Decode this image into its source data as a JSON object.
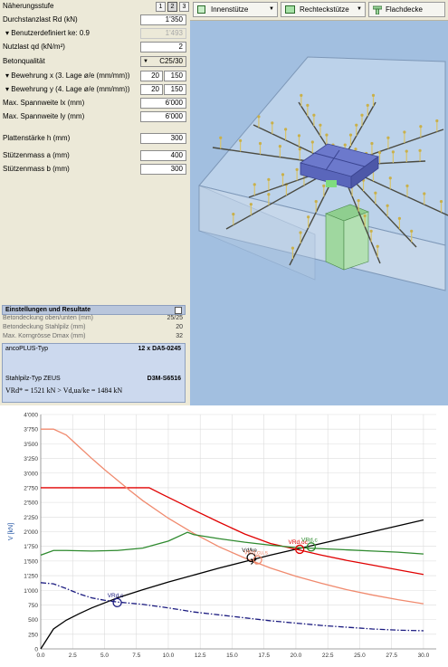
{
  "left_panel": {
    "approx_level_label": "Näherungsstufe",
    "levels": [
      "1",
      "2",
      "3"
    ],
    "active_level": "2",
    "punching_load_label": "Durchstanzlast Rd (kN)",
    "punching_load_value": "1'350",
    "user_defined_label": "Benutzerdefiniert ke: 0.9",
    "user_defined_value": "1'493",
    "live_load_label": "Nutzlast qd (kN/m²)",
    "live_load_value": "2",
    "concrete_label": "Betonqualität",
    "concrete_value": "C25/30",
    "rebar_x_label": "Bewehrung x (3. Lage ø/e (mm/mm))",
    "rebar_x_diameter": "20",
    "rebar_x_spacing": "150",
    "rebar_y_label": "Bewehrung y (4. Lage ø/e (mm/mm))",
    "rebar_y_diameter": "20",
    "rebar_y_spacing": "150",
    "span_x_label": "Max. Spannweite lx  (mm)",
    "span_x_value": "6'000",
    "span_y_label": "Max. Spannweite ly  (mm)",
    "span_y_value": "6'000",
    "slab_label": "Plattenstärke h (mm)",
    "slab_value": "300",
    "col_a_label": "Stützenmass a (mm)",
    "col_a_value": "400",
    "col_b_label": "Stützenmass b (mm)",
    "col_b_value": "300"
  },
  "settings": {
    "title": "Einstellungen und Resultate",
    "rows": [
      {
        "label": "Betondeckung oben/unten (mm)",
        "value": "25/25"
      },
      {
        "label": "Betondeckung Stahlpilz (mm)",
        "value": "20"
      },
      {
        "label": "Max. Korngrösse Dmax (mm)",
        "value": "32"
      }
    ]
  },
  "result": {
    "type_label": "ancoPLUS-Typ",
    "type_value": "12 x DA5-0245",
    "steel_label": "Stahlpilz-Typ ZEUS",
    "steel_value": "D3M-S6516",
    "formula": "VRd* = 1521 kN > Vd,ua/ke = 1484 kN"
  },
  "toolbar": {
    "inner_column": "Innenstütze",
    "rect_column": "Rechteckstütze",
    "flat_slab": "Flachdecke"
  },
  "colors": {
    "panel_bg": "#ece9d8",
    "view_bg": "#a2bfe0",
    "result_bg": "#ccd9ee",
    "series_black": "#000000",
    "series_red": "#e00000",
    "series_salmon": "#f08a6e",
    "series_green": "#2f8a2f",
    "series_navy": "#1b1b80"
  },
  "chart_data": {
    "type": "line",
    "ylabel": "V [kN]",
    "ylim": [
      0,
      4000
    ],
    "xlim": [
      0,
      31
    ],
    "y_ticks": [
      "4'000",
      "3'750",
      "3'500",
      "3'250",
      "3'000",
      "2'750",
      "2'500",
      "2'250",
      "2'000",
      "1'750",
      "1'500",
      "1'250",
      "1'000",
      "750",
      "500",
      "250",
      "0"
    ],
    "x_ticks": [
      "0.0",
      "2.5",
      "5.0",
      "7.5",
      "10.0",
      "12.5",
      "15.0",
      "17.5",
      "20.0",
      "22.5",
      "25.0",
      "27.5",
      "30.0"
    ],
    "grid": true,
    "series": [
      {
        "name": "",
        "style": "solid",
        "color": "#000000",
        "x": [
          0,
          1,
          2,
          3,
          4,
          6,
          8,
          10,
          12,
          14,
          16,
          18,
          20,
          22,
          24,
          26,
          28,
          30
        ],
        "y": [
          0,
          340,
          490,
          600,
          700,
          870,
          1010,
          1140,
          1260,
          1380,
          1490,
          1600,
          1700,
          1800,
          1900,
          2000,
          2100,
          2200
        ]
      },
      {
        "name": "",
        "style": "solid",
        "color": "#e00000",
        "x": [
          0,
          1,
          3,
          5,
          7,
          8.5,
          9.5,
          11,
          12,
          14,
          16,
          18,
          20,
          22,
          24,
          26,
          28,
          30
        ],
        "y": [
          2750,
          2750,
          2750,
          2750,
          2750,
          2750,
          2640,
          2480,
          2370,
          2160,
          1960,
          1800,
          1700,
          1600,
          1510,
          1430,
          1350,
          1270
        ]
      },
      {
        "name": "",
        "style": "solid",
        "color": "#f08a6e",
        "x": [
          0,
          1,
          2,
          3,
          4,
          5,
          6,
          7,
          8,
          10,
          12,
          14,
          16,
          18,
          20,
          22,
          24,
          26,
          28,
          30
        ],
        "y": [
          3750,
          3750,
          3650,
          3450,
          3250,
          3060,
          2880,
          2700,
          2530,
          2230,
          1970,
          1740,
          1550,
          1380,
          1240,
          1120,
          1010,
          920,
          840,
          770
        ]
      },
      {
        "name": "",
        "style": "solid",
        "color": "#2f8a2f",
        "x": [
          0,
          1,
          2,
          4,
          6,
          8,
          10,
          11.5,
          12,
          14,
          16,
          18,
          20,
          22,
          24,
          26,
          28,
          30
        ],
        "y": [
          1600,
          1680,
          1680,
          1670,
          1680,
          1720,
          1840,
          1990,
          1950,
          1880,
          1820,
          1770,
          1730,
          1710,
          1690,
          1670,
          1650,
          1620
        ]
      },
      {
        "name": "",
        "style": "dashdot",
        "color": "#1b1b80",
        "x": [
          0,
          1,
          2,
          3,
          4,
          5,
          6,
          8,
          10,
          12,
          14,
          16,
          18,
          20,
          22,
          24,
          26,
          28,
          30
        ],
        "y": [
          1130,
          1110,
          1030,
          940,
          870,
          830,
          800,
          760,
          700,
          630,
          580,
          530,
          480,
          440,
          400,
          370,
          340,
          320,
          310
        ]
      }
    ],
    "annotations": [
      {
        "text": "VRd,c",
        "x": 6.0,
        "y": 790,
        "color": "#1b1b80"
      },
      {
        "text": "Vd/ke",
        "x": 16.5,
        "y": 1560,
        "color": "#000000"
      },
      {
        "text": "",
        "x": 16.7,
        "y": 1490,
        "color": "#000000"
      },
      {
        "text": "VRd,cu,s",
        "x": 17.0,
        "y": 1520,
        "color": "#f08a6e"
      },
      {
        "text": "VRd,oc",
        "x": 20.3,
        "y": 1700,
        "color": "#e00000"
      },
      {
        "text": "VRd,c",
        "x": 21.2,
        "y": 1740,
        "color": "#2f8a2f"
      }
    ]
  }
}
